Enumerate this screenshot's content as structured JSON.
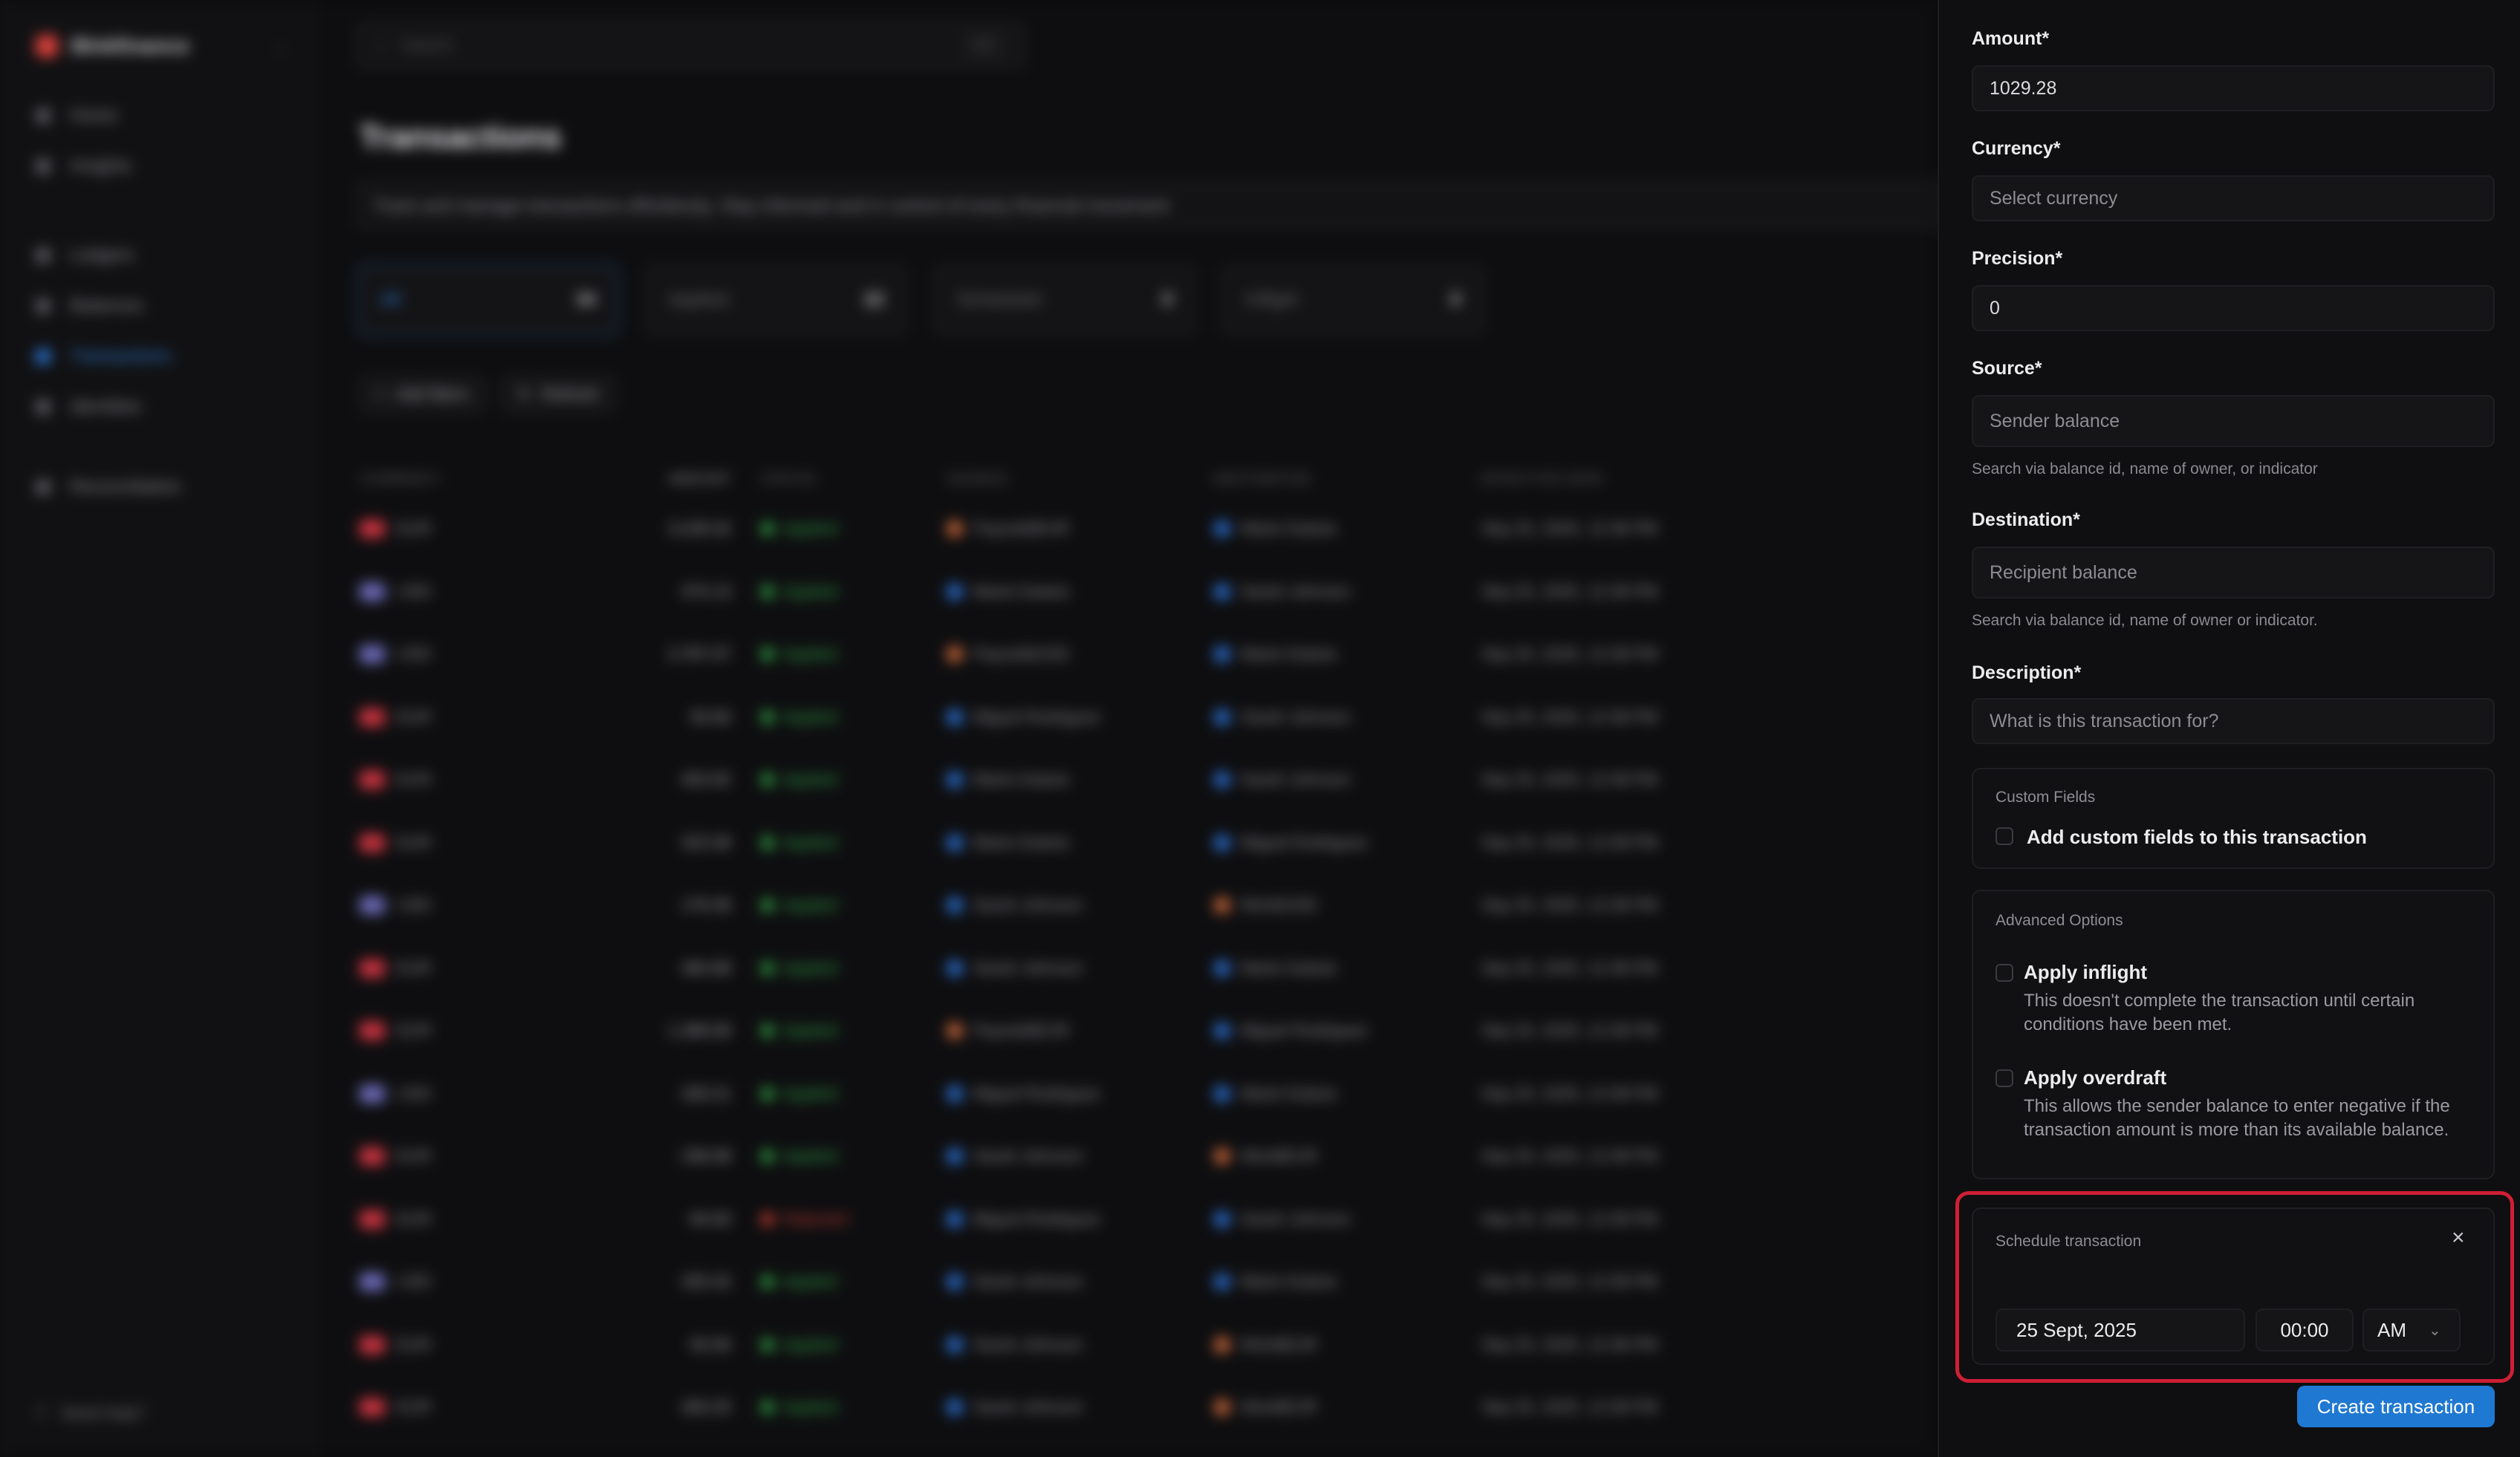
{
  "background": {
    "app_name": "Blnkfinance",
    "nav": [
      "Home",
      "Insights",
      "Ledgers",
      "Balances",
      "Transactions",
      "Identities",
      "Reconciliation"
    ],
    "active_nav": "Transactions",
    "help": "Need help?",
    "search_placeholder": "Search",
    "search_kbd": "⌘K",
    "title": "Transactions",
    "subtitle": "Track and manage transactions effortlessly. Stay informed and in control of every financial movement",
    "tabs": [
      {
        "label": "All",
        "count": "34"
      },
      {
        "label": "Applied",
        "count": "22"
      },
      {
        "label": "Scheduled",
        "count": "0"
      },
      {
        "label": "Inflight",
        "count": "0"
      }
    ],
    "actions": [
      "Add filters",
      "Refresh"
    ],
    "columns": [
      "CURRENCY",
      "AMOUNT",
      "STATUS",
      "SOURCE",
      "DESTINATION",
      "EFFECTIVE DATE"
    ],
    "rows": [
      {
        "currency": "EUR",
        "flag": "eu",
        "amount": "3,228.32",
        "status": "Applied",
        "source": "PaysolidEUR",
        "src_color": "orange",
        "destination": "Marie Dubois",
        "dst_color": "blue",
        "date": "Sep 25, 2025, 12:38 PM"
      },
      {
        "currency": "USD",
        "flag": "us",
        "amount": "374.13",
        "status": "Applied",
        "source": "Marie Dubois",
        "src_color": "blue",
        "destination": "Sarah Johnson",
        "dst_color": "blue",
        "date": "Sep 25, 2025, 12:38 PM"
      },
      {
        "currency": "USD",
        "flag": "us",
        "amount": "3,787.07",
        "status": "Applied",
        "source": "PaysolidUSD",
        "src_color": "orange",
        "destination": "Marie Dubois",
        "dst_color": "blue",
        "date": "Sep 25, 2025, 12:38 PM"
      },
      {
        "currency": "EUR",
        "flag": "eu",
        "amount": "93.83",
        "status": "Applied",
        "source": "Miguel Rodriguez",
        "src_color": "blue",
        "destination": "Sarah Johnson",
        "dst_color": "blue",
        "date": "Sep 25, 2025, 12:38 PM"
      },
      {
        "currency": "EUR",
        "flag": "eu",
        "amount": "453.92",
        "status": "Applied",
        "source": "Marie Dubois",
        "src_color": "blue",
        "destination": "Sarah Johnson",
        "dst_color": "blue",
        "date": "Sep 25, 2025, 12:38 PM"
      },
      {
        "currency": "EUR",
        "flag": "eu",
        "amount": "323.36",
        "status": "Applied",
        "source": "Marie Dubois",
        "src_color": "blue",
        "destination": "Miguel Rodriguez",
        "dst_color": "blue",
        "date": "Sep 25, 2025, 12:38 PM"
      },
      {
        "currency": "USD",
        "flag": "us",
        "amount": "178.48",
        "status": "Applied",
        "source": "Sarah Johnson",
        "src_color": "blue",
        "destination": "WorldUSD",
        "dst_color": "orange",
        "date": "Sep 25, 2025, 12:38 PM"
      },
      {
        "currency": "EUR",
        "flag": "eu",
        "amount": "484.88",
        "status": "Applied",
        "source": "Sarah Johnson",
        "src_color": "blue",
        "destination": "Marie Dubois",
        "dst_color": "blue",
        "date": "Sep 25, 2025, 12:38 PM"
      },
      {
        "currency": "EUR",
        "flag": "eu",
        "amount": "1,388.08",
        "status": "Applied",
        "source": "PaysolidEUR",
        "src_color": "orange",
        "destination": "Miguel Rodriguez",
        "dst_color": "blue",
        "date": "Sep 25, 2025, 12:38 PM"
      },
      {
        "currency": "USD",
        "flag": "us",
        "amount": "328.21",
        "status": "Applied",
        "source": "Miguel Rodriguez",
        "src_color": "blue",
        "destination": "Marie Dubois",
        "dst_color": "blue",
        "date": "Sep 25, 2025, 12:38 PM"
      },
      {
        "currency": "EUR",
        "flag": "eu",
        "amount": "238.08",
        "status": "Applied",
        "source": "Sarah Johnson",
        "src_color": "blue",
        "destination": "WorldEUR",
        "dst_color": "orange",
        "date": "Sep 25, 2025, 12:38 PM"
      },
      {
        "currency": "EUR",
        "flag": "eu",
        "amount": "84.83",
        "status": "Rejected",
        "source": "Miguel Rodriguez",
        "src_color": "blue",
        "destination": "Sarah Johnson",
        "dst_color": "blue",
        "date": "Sep 25, 2025, 12:38 PM"
      },
      {
        "currency": "USD",
        "flag": "us",
        "amount": "333.42",
        "status": "Applied",
        "source": "Sarah Johnson",
        "src_color": "blue",
        "destination": "Marie Dubois",
        "dst_color": "blue",
        "date": "Sep 25, 2025, 12:38 PM"
      },
      {
        "currency": "EUR",
        "flag": "eu",
        "amount": "92.83",
        "status": "Applied",
        "source": "Sarah Johnson",
        "src_color": "blue",
        "destination": "WorldEUR",
        "dst_color": "orange",
        "date": "Sep 25, 2025, 12:38 PM"
      },
      {
        "currency": "EUR",
        "flag": "eu",
        "amount": "283.25",
        "status": "Applied",
        "source": "Sarah Johnson",
        "src_color": "blue",
        "destination": "WorldEUR",
        "dst_color": "orange",
        "date": "Sep 25, 2025, 12:38 PM"
      }
    ]
  },
  "form": {
    "amount": {
      "label": "Amount*",
      "value": "1029.28"
    },
    "currency": {
      "label": "Currency*",
      "placeholder": "Select currency"
    },
    "precision": {
      "label": "Precision*",
      "value": "0"
    },
    "source": {
      "label": "Source*",
      "placeholder": "Sender balance",
      "hint": "Search via balance id, name of owner, or indicator"
    },
    "destination": {
      "label": "Destination*",
      "placeholder": "Recipient balance",
      "hint": "Search via balance id, name of owner or indicator."
    },
    "description": {
      "label": "Description*",
      "placeholder": "What is this transaction for?"
    },
    "custom_fields": {
      "title": "Custom Fields",
      "checkbox_label": "Add custom fields to this transaction"
    },
    "advanced": {
      "title": "Advanced Options",
      "inflight_label": "Apply inflight",
      "inflight_desc": "This doesn't complete the transaction until certain conditions have been met.",
      "overdraft_label": "Apply overdraft",
      "overdraft_desc": "This allows the sender balance to enter negative if the transaction amount is more than its available balance."
    },
    "schedule": {
      "title": "Schedule transaction",
      "close_icon": "×",
      "date": "25 Sept, 2025",
      "time": "00:00",
      "meridiem": "AM",
      "chevron": "⌄"
    },
    "submit_label": "Create transaction"
  },
  "colors": {
    "accent": "#1f78d1",
    "highlight": "#cf1f35",
    "applied": "#2ea043",
    "rejected": "#c43b2f"
  }
}
